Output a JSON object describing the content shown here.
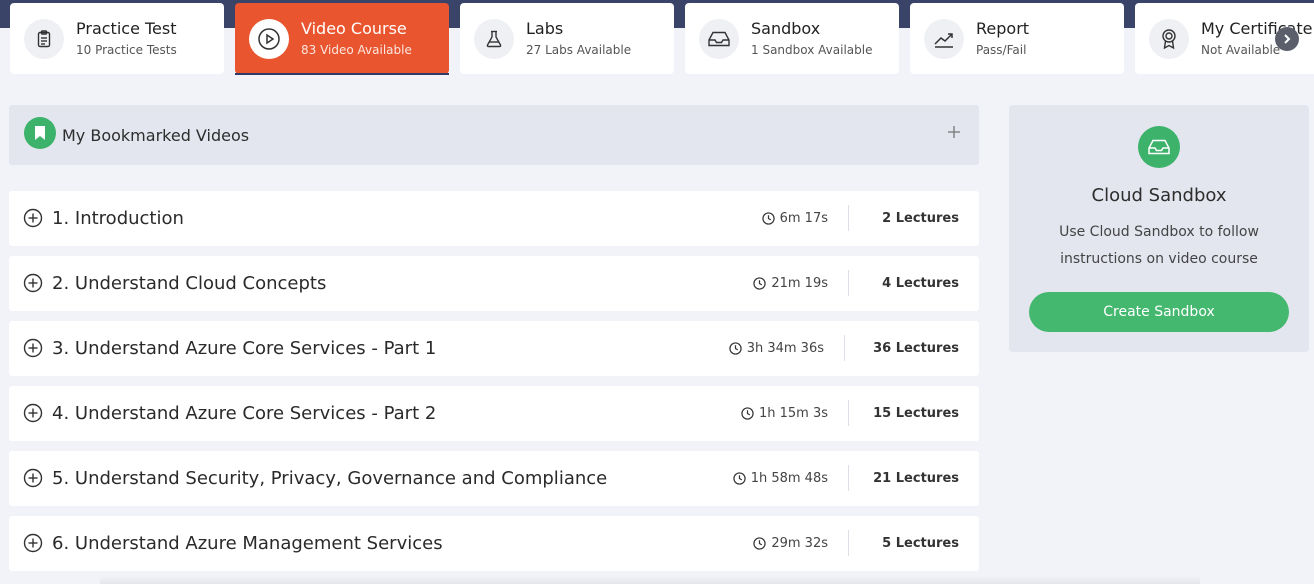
{
  "tabs": [
    {
      "title": "Practice Test",
      "subtitle": "10 Practice Tests",
      "icon": "clipboard-icon",
      "active": false
    },
    {
      "title": "Video Course",
      "subtitle": "83 Video Available",
      "icon": "play-icon",
      "active": true
    },
    {
      "title": "Labs",
      "subtitle": "27 Labs Available",
      "icon": "flask-icon",
      "active": false
    },
    {
      "title": "Sandbox",
      "subtitle": "1 Sandbox Available",
      "icon": "inbox-icon",
      "active": false
    },
    {
      "title": "Report",
      "subtitle": "Pass/Fail",
      "icon": "trend-icon",
      "active": false
    },
    {
      "title": "My Certificate",
      "subtitle": "Not Available",
      "icon": "award-icon",
      "active": false
    }
  ],
  "bookmarks": {
    "label": "My Bookmarked Videos"
  },
  "sections": [
    {
      "title": "1. Introduction",
      "duration": "6m 17s",
      "lectures": "2 Lectures"
    },
    {
      "title": "2. Understand Cloud Concepts",
      "duration": "21m 19s",
      "lectures": "4 Lectures"
    },
    {
      "title": "3. Understand Azure Core Services - Part 1",
      "duration": "3h 34m 36s",
      "lectures": "36 Lectures"
    },
    {
      "title": "4. Understand Azure Core Services - Part 2",
      "duration": "1h 15m 3s",
      "lectures": "15 Lectures"
    },
    {
      "title": "5. Understand Security, Privacy, Governance and Compliance",
      "duration": "1h 58m 48s",
      "lectures": "21 Lectures"
    },
    {
      "title": "6. Understand Azure Management Services",
      "duration": "29m 32s",
      "lectures": "5 Lectures"
    }
  ],
  "sandbox": {
    "title": "Cloud Sandbox",
    "description": "Use Cloud Sandbox to follow instructions on video course",
    "button_label": "Create Sandbox"
  },
  "colors": {
    "accent": "#e9552e",
    "green": "#3cb26b",
    "nav_dark": "#3a4468"
  }
}
